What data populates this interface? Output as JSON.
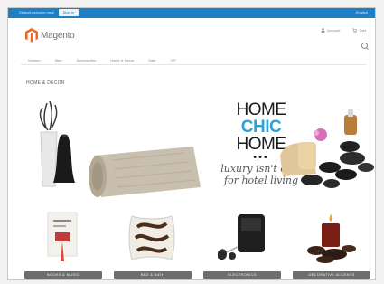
{
  "topbar": {
    "welcome": "Default welcome msg!",
    "account": "Sign In",
    "language": "English"
  },
  "header": {
    "logo_text": "Magento",
    "account_label": "Account",
    "cart_label": "Cart"
  },
  "nav": {
    "items": [
      "Women",
      "Men",
      "Accessories",
      "Home & Decor",
      "Sale",
      "VIP"
    ]
  },
  "breadcrumb": "HOME & DECOR",
  "hero": {
    "line1": "HOME",
    "line2": "CHIC",
    "line3": "HOME",
    "dots": "•••",
    "tagline1": "luxury isn't only",
    "tagline2": "for hotel living"
  },
  "categories": [
    {
      "label": "BOOKS & MUSIC"
    },
    {
      "label": "BED & BATH"
    },
    {
      "label": "ELECTRONICS"
    },
    {
      "label": "DECORATIVE ACCENTS"
    }
  ],
  "colors": {
    "topbar": "#1f7fc5",
    "chic": "#2aa3d9",
    "logo": "#f26322",
    "button": "#6e6e6e"
  }
}
